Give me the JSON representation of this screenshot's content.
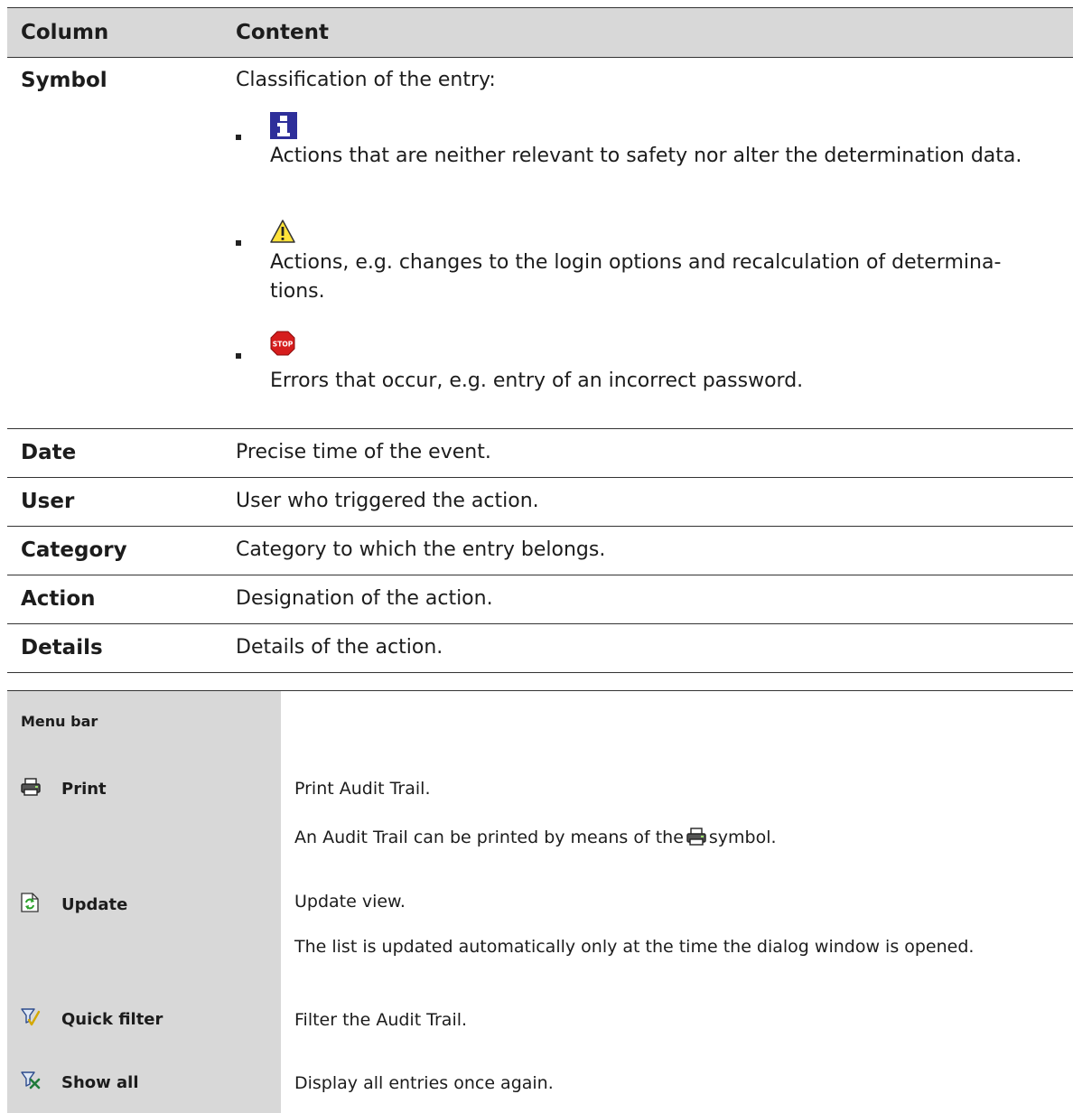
{
  "table": {
    "header": {
      "column": "Column",
      "content": "Content"
    },
    "symbol": {
      "name": "Symbol",
      "intro": "Classification of the entry:",
      "items": [
        {
          "icon": "info-icon",
          "text": "Actions that are neither relevant to safety nor alter the determination data."
        },
        {
          "icon": "warning-icon",
          "text": "Actions, e.g. changes to the login options and recalculation of determina-tions."
        },
        {
          "icon": "stop-icon",
          "icon_text": "STOP",
          "text": "Errors that occur, e.g. entry of an incorrect password."
        }
      ]
    },
    "rows": [
      {
        "name": "Date",
        "desc": "Precise time of the event."
      },
      {
        "name": "User",
        "desc": "User who triggered the action."
      },
      {
        "name": "Category",
        "desc": "Category to which the entry belongs."
      },
      {
        "name": "Action",
        "desc": "Designation of the action."
      },
      {
        "name": "Details",
        "desc": "Details of the action."
      }
    ]
  },
  "menu": {
    "title": "Menu bar",
    "items": [
      {
        "icon": "printer-icon",
        "label": "Print",
        "desc": "Print Audit Trail.",
        "desc2_before": "An Audit Trail can be printed by means of the",
        "desc2_after": "symbol."
      },
      {
        "icon": "refresh-icon",
        "label": "Update",
        "desc": "Update view.",
        "desc2": "The list is updated automatically only at the time the dialog window is opened."
      },
      {
        "icon": "quick-filter-icon",
        "label": "Quick filter",
        "desc": "Filter the Audit Trail."
      },
      {
        "icon": "show-all-filter-icon",
        "label": "Show all",
        "desc": "Display all entries once again."
      }
    ]
  }
}
